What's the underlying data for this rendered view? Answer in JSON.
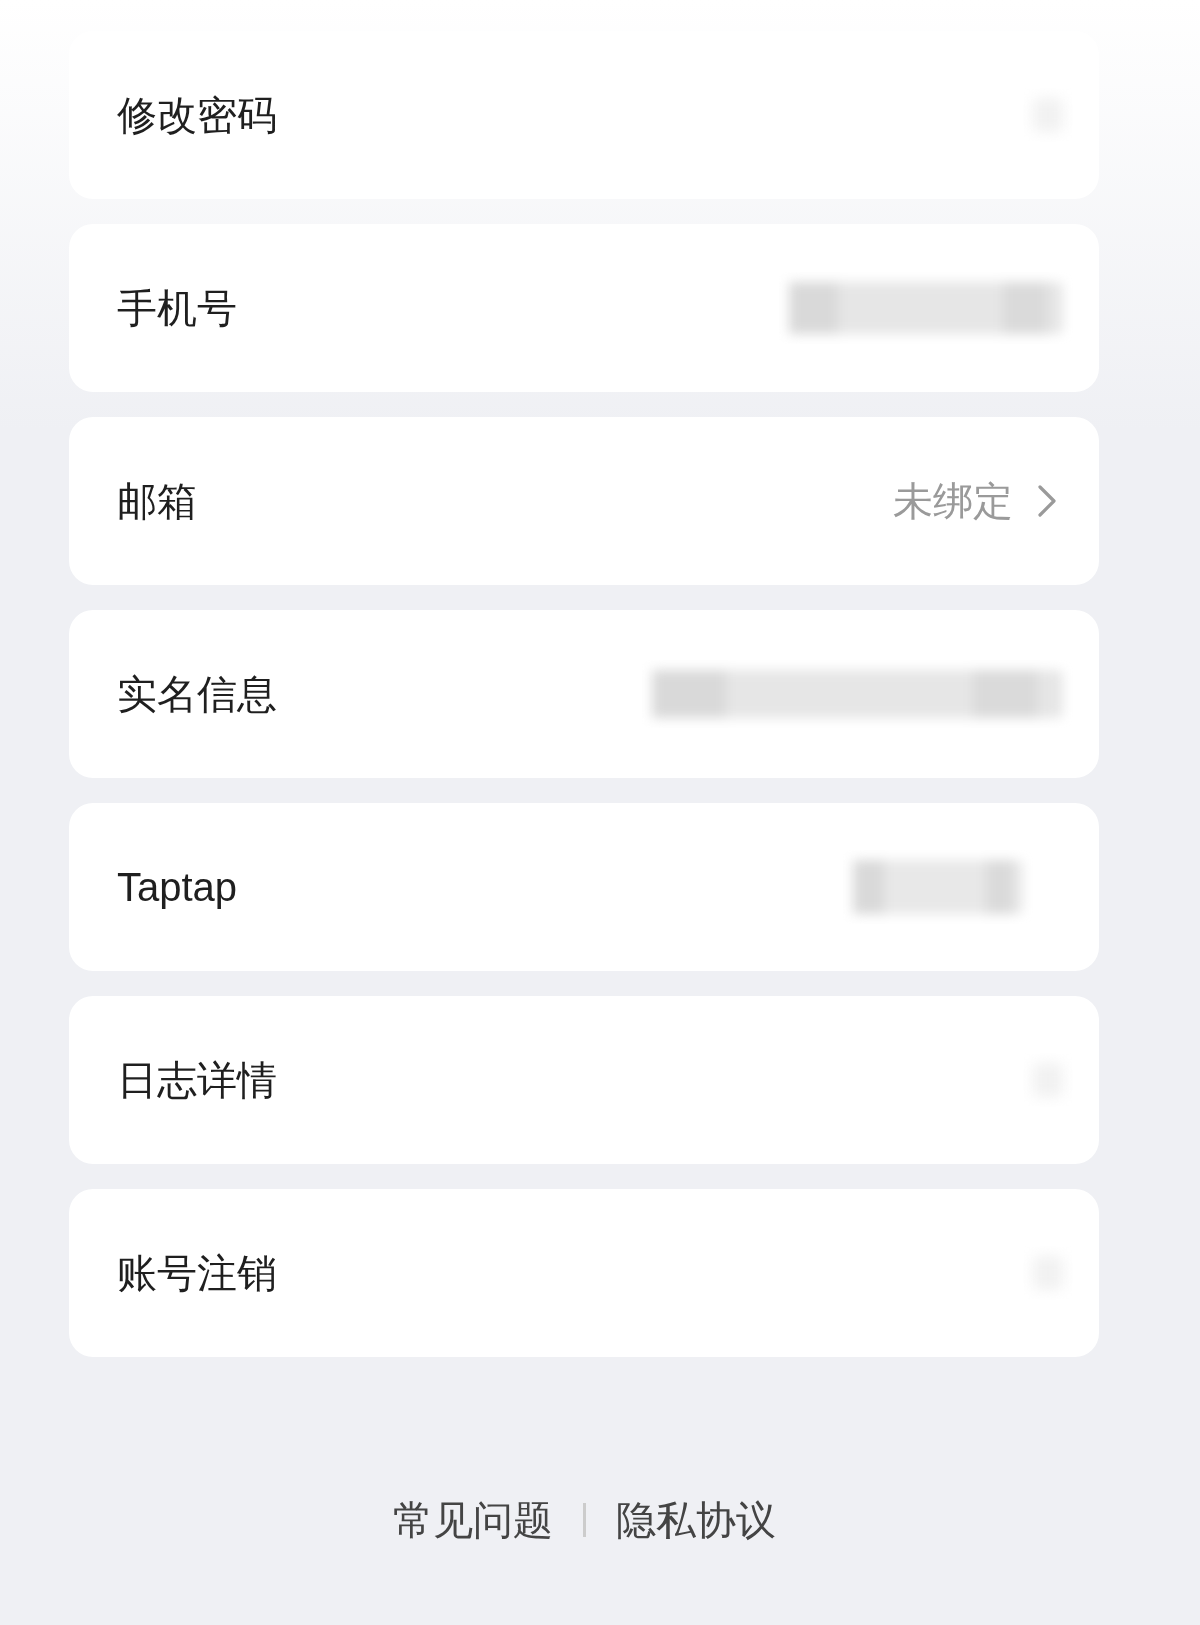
{
  "rows": [
    {
      "label": "修改密码",
      "trailing": {
        "kind": "redacted_icon"
      }
    },
    {
      "label": "手机号",
      "trailing": {
        "kind": "redacted_long"
      }
    },
    {
      "label": "邮箱",
      "trailing": {
        "kind": "value",
        "text": "未绑定",
        "chevron": true
      }
    },
    {
      "label": "实名信息",
      "trailing": {
        "kind": "redacted_wide"
      }
    },
    {
      "label": "Taptap",
      "trailing": {
        "kind": "redacted_medium"
      }
    },
    {
      "label": "日志详情",
      "trailing": {
        "kind": "redacted_icon"
      }
    },
    {
      "label": "账号注销",
      "trailing": {
        "kind": "redacted_icon"
      }
    }
  ],
  "footer_links": [
    "常见问题",
    "隐私协议"
  ]
}
